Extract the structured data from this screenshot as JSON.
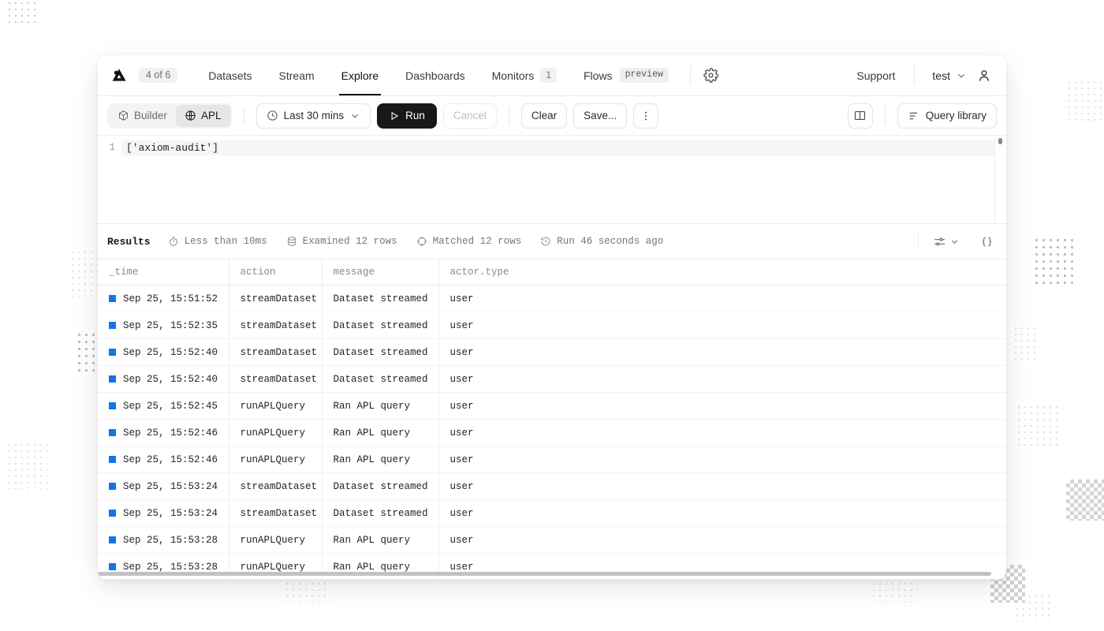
{
  "nav": {
    "logo_name": "axiom-logo",
    "org_badge": "4 of 6",
    "items": [
      {
        "label": "Datasets",
        "active": false
      },
      {
        "label": "Stream",
        "active": false
      },
      {
        "label": "Explore",
        "active": true
      },
      {
        "label": "Dashboards",
        "active": false
      },
      {
        "label": "Monitors",
        "active": false,
        "count": "1"
      },
      {
        "label": "Flows",
        "active": false,
        "tag": "preview"
      }
    ],
    "settings_icon": "gear-icon",
    "support_label": "Support",
    "account_label": "test",
    "account_chevron": "chevron-down-icon",
    "avatar_icon": "user-icon"
  },
  "toolbar": {
    "mode_builder": "Builder",
    "mode_apl": "APL",
    "mode_active": "APL",
    "time_range": "Last 30 mins",
    "run_label": "Run",
    "cancel_label": "Cancel",
    "clear_label": "Clear",
    "save_label": "Save...",
    "more_icon": "more-vertical-icon",
    "panel_icon": "book-open-icon",
    "query_library_label": "Query library"
  },
  "editor": {
    "line_number": "1",
    "query": "['axiom-audit']"
  },
  "results": {
    "title": "Results",
    "stats": [
      {
        "icon": "stopwatch-icon",
        "text": "Less than 10ms"
      },
      {
        "icon": "database-icon",
        "text": "Examined 12 rows"
      },
      {
        "icon": "target-icon",
        "text": "Matched 12 rows"
      },
      {
        "icon": "history-icon",
        "text": "Run 46 seconds ago"
      }
    ],
    "settings_icon": "sliders-icon",
    "settings_chevron": "chevron-down-icon",
    "json_icon": "braces-icon"
  },
  "table": {
    "columns": [
      "_time",
      "action",
      "message",
      "actor.type"
    ],
    "rows": [
      {
        "_time": "Sep 25, 15:51:52",
        "action": "streamDataset",
        "message": "Dataset streamed",
        "actor_type": "user"
      },
      {
        "_time": "Sep 25, 15:52:35",
        "action": "streamDataset",
        "message": "Dataset streamed",
        "actor_type": "user"
      },
      {
        "_time": "Sep 25, 15:52:40",
        "action": "streamDataset",
        "message": "Dataset streamed",
        "actor_type": "user"
      },
      {
        "_time": "Sep 25, 15:52:40",
        "action": "streamDataset",
        "message": "Dataset streamed",
        "actor_type": "user"
      },
      {
        "_time": "Sep 25, 15:52:45",
        "action": "runAPLQuery",
        "message": "Ran APL query",
        "actor_type": "user"
      },
      {
        "_time": "Sep 25, 15:52:46",
        "action": "runAPLQuery",
        "message": "Ran APL query",
        "actor_type": "user"
      },
      {
        "_time": "Sep 25, 15:52:46",
        "action": "runAPLQuery",
        "message": "Ran APL query",
        "actor_type": "user"
      },
      {
        "_time": "Sep 25, 15:53:24",
        "action": "streamDataset",
        "message": "Dataset streamed",
        "actor_type": "user"
      },
      {
        "_time": "Sep 25, 15:53:24",
        "action": "streamDataset",
        "message": "Dataset streamed",
        "actor_type": "user"
      },
      {
        "_time": "Sep 25, 15:53:28",
        "action": "runAPLQuery",
        "message": "Ran APL query",
        "actor_type": "user"
      },
      {
        "_time": "Sep 25, 15:53:28",
        "action": "runAPLQuery",
        "message": "Ran APL query",
        "actor_type": "user"
      }
    ]
  },
  "colors": {
    "accent_blue": "#1473e6",
    "run_button_bg": "#18181b",
    "text_primary": "#18181b",
    "text_muted": "#767676"
  }
}
